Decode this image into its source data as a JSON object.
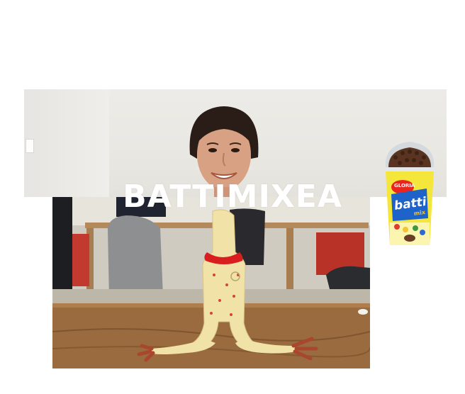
{
  "overlay": {
    "title": "BATTIMIXEA"
  },
  "product": {
    "brand": "GLORIA",
    "name": "batti",
    "suffix": "mix"
  },
  "colors": {
    "background": "#ffffff",
    "title_text": "#ffffff",
    "wall": "#ebeae6",
    "desk_wood": "#9a6b3e",
    "chicken": "#f1e3a8",
    "chicken_bow": "#d81e1e",
    "product_label": "#f4e63a",
    "product_lid": "#cfd6da"
  }
}
